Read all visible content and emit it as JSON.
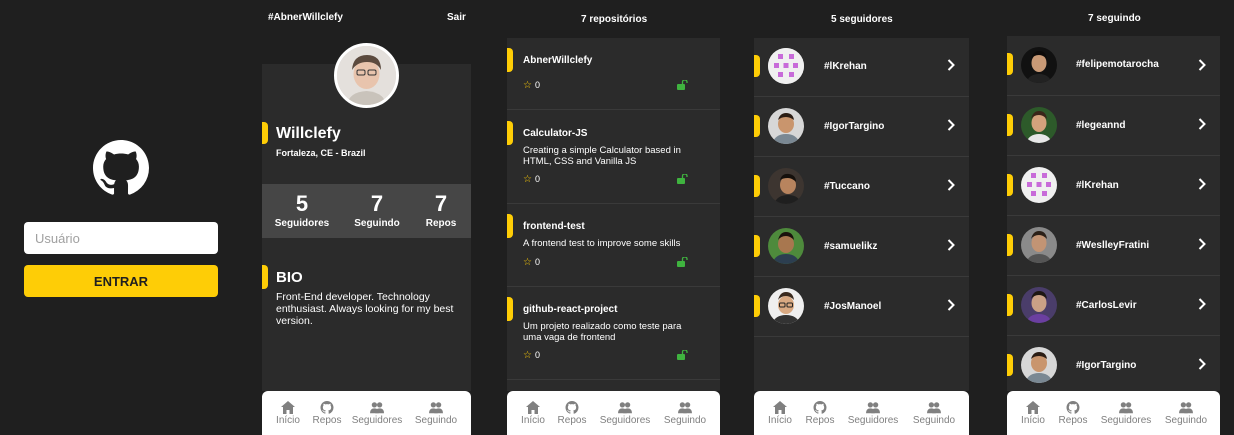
{
  "login": {
    "username_placeholder": "Usuário",
    "submit_label": "ENTRAR"
  },
  "profile": {
    "header_user": "#AbnerWillclefy",
    "logout_label": "Sair",
    "name": "Willclefy",
    "location": "Fortaleza, CE - Brazil",
    "stats": [
      {
        "value": "5",
        "label": "Seguidores"
      },
      {
        "value": "7",
        "label": "Seguindo"
      },
      {
        "value": "7",
        "label": "Repos"
      }
    ],
    "bio_title": "BIO",
    "bio_text": "Front-End developer. Technology enthusiast. Always looking for my best version."
  },
  "nav": {
    "home": "Início",
    "repos": "Repos",
    "followers": "Seguidores",
    "following": "Seguindo"
  },
  "repos": {
    "header": "7 repositórios",
    "items": [
      {
        "name": "AbnerWillclefy",
        "description": "",
        "stars": "0"
      },
      {
        "name": "Calculator-JS",
        "description": "Creating a simple Calculator based in HTML, CSS and Vanilla JS",
        "stars": "0"
      },
      {
        "name": "frontend-test",
        "description": "A frontend test to improve some skills",
        "stars": "0"
      },
      {
        "name": "github-react-project",
        "description": "Um projeto realizado como teste para uma vaga de frontend",
        "stars": "0"
      }
    ]
  },
  "followers": {
    "header": "5 seguidores",
    "items": [
      {
        "login": "#lKrehan"
      },
      {
        "login": "#IgorTargino"
      },
      {
        "login": "#Tuccano"
      },
      {
        "login": "#samuelikz"
      },
      {
        "login": "#JosManoel"
      }
    ]
  },
  "following": {
    "header": "7 seguindo",
    "items": [
      {
        "login": "#felipemotarocha"
      },
      {
        "login": "#legeannd"
      },
      {
        "login": "#lKrehan"
      },
      {
        "login": "#WeslleyFratini"
      },
      {
        "login": "#CarlosLevir"
      },
      {
        "login": "#IgorTargino"
      }
    ]
  },
  "colors": {
    "accent": "#fecd06",
    "background": "#1f1f1f",
    "panel": "#2b2b2b",
    "lock_green": "#3fb33f"
  }
}
